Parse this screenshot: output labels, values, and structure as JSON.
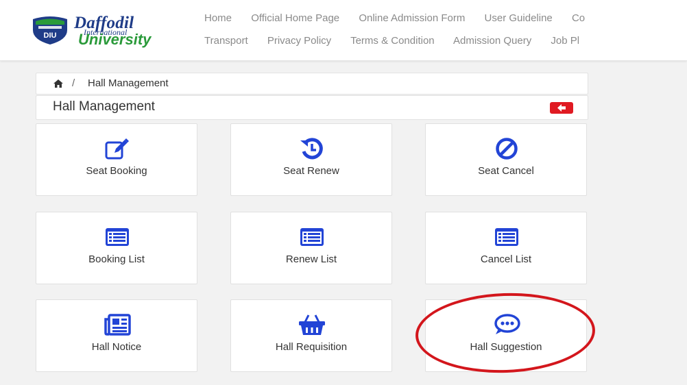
{
  "header": {
    "logo": {
      "line1": "Daffodil",
      "line2": "International",
      "line3": "University",
      "badge": "DIU"
    },
    "nav_row1": [
      "Home",
      "Official Home Page",
      "Online Admission Form",
      "User Guideline",
      "Co"
    ],
    "nav_row2": [
      "Transport",
      "Privacy Policy",
      "Terms & Condition",
      "Admission Query",
      "Job Pl"
    ]
  },
  "breadcrumb": {
    "home_icon": "home-icon",
    "separator": "/",
    "current": "Hall Management"
  },
  "page": {
    "title": "Hall Management",
    "back_icon": "arrow-left-icon",
    "back_color": "#e01a22"
  },
  "cards": [
    {
      "label": "Seat Booking",
      "icon": "edit-icon"
    },
    {
      "label": "Seat Renew",
      "icon": "history-icon"
    },
    {
      "label": "Seat Cancel",
      "icon": "ban-icon"
    },
    {
      "label": "Booking List",
      "icon": "list-icon"
    },
    {
      "label": "Renew List",
      "icon": "list-icon"
    },
    {
      "label": "Cancel List",
      "icon": "list-icon"
    },
    {
      "label": "Hall Notice",
      "icon": "newspaper-icon"
    },
    {
      "label": "Hall Requisition",
      "icon": "basket-icon"
    },
    {
      "label": "Hall Suggestion",
      "icon": "comment-dots-icon"
    }
  ],
  "colors": {
    "icon_blue": "#2244d6",
    "highlight_red": "#d3161c",
    "brand_blue": "#1f3c88",
    "brand_green": "#2a9a3a"
  }
}
